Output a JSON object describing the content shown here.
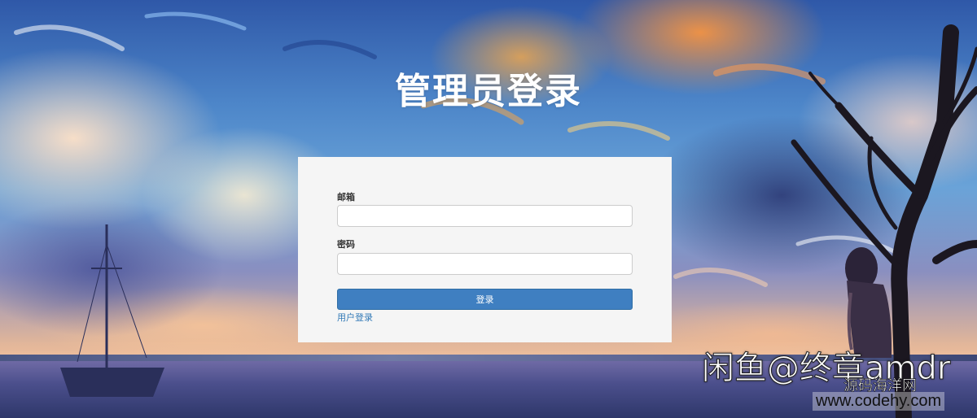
{
  "page": {
    "title": "管理员登录"
  },
  "login_form": {
    "email_label": "邮箱",
    "email_value": "",
    "password_label": "密码",
    "password_value": "",
    "submit_label": "登录",
    "user_login_link": "用户登录"
  },
  "watermark": {
    "line1": "闲鱼@终章amdr",
    "line2": "源码海洋网",
    "line3": "www.codehy.com"
  },
  "colors": {
    "card_background": "#f5f5f5",
    "button": "#3f7fc1",
    "link": "#337ab7",
    "title": "#ffffff"
  }
}
